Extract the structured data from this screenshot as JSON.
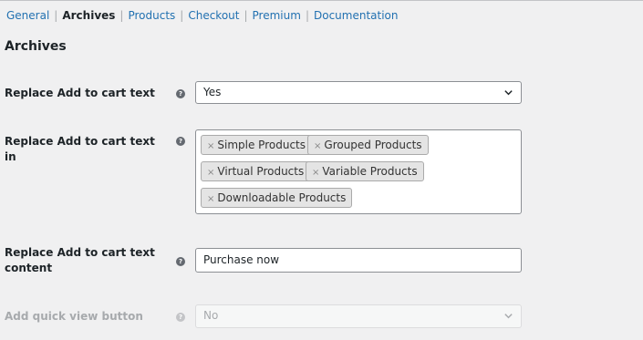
{
  "subnav": {
    "items": [
      {
        "label": "General"
      },
      {
        "label": "Archives"
      },
      {
        "label": "Products"
      },
      {
        "label": "Checkout"
      },
      {
        "label": "Premium"
      },
      {
        "label": "Documentation"
      }
    ],
    "separator": "|",
    "current": "Archives"
  },
  "section": {
    "title": "Archives"
  },
  "fields": {
    "replace_text": {
      "label": "Replace Add to cart text",
      "value": "Yes"
    },
    "replace_text_in": {
      "label": "Replace Add to cart text in",
      "chips": [
        "Simple Products",
        "Grouped Products",
        "Virtual Products",
        "Variable Products",
        "Downloadable Products"
      ],
      "remove_glyph": "×"
    },
    "replace_text_content": {
      "label_line1": "Replace Add to cart text",
      "label_line2": "content",
      "value": "Purchase now"
    },
    "quick_view": {
      "label": "Add quick view button",
      "value": "No"
    }
  },
  "help_glyph": "?",
  "colors": {
    "link": "#2271b1",
    "background": "#f0f0f1",
    "text": "#1d2327",
    "disabled": "#a7aaad"
  }
}
